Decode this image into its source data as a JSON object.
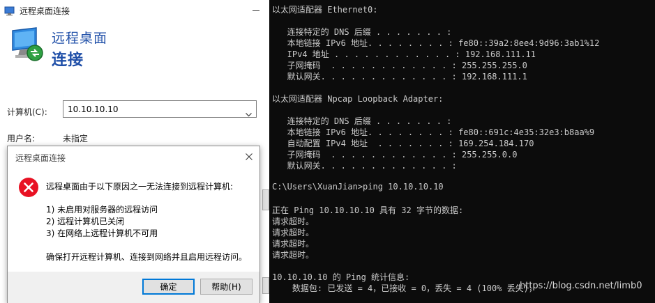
{
  "rdp_window": {
    "title": "远程桌面连接",
    "banner_title": "远程桌面",
    "banner_subtitle": "连接",
    "computer_label": "计算机(C):",
    "computer_value": "10.10.10.10",
    "username_label": "用户名:",
    "username_value": "未指定"
  },
  "error_dialog": {
    "title": "远程桌面连接",
    "message": "远程桌面由于以下原因之一无法连接到远程计算机:",
    "reasons": [
      "1) 未启用对服务器的远程访问",
      "2) 远程计算机已关闭",
      "3) 在网络上远程计算机不可用"
    ],
    "hint": "确保打开远程计算机、连接到网络并且启用远程访问。",
    "ok_label": "确定",
    "help_label": "帮助(H)"
  },
  "console": {
    "lines": [
      "以太网适配器 Ethernet0:",
      "",
      "   连接特定的 DNS 后缀 . . . . . . . :",
      "   本地链接 IPv6 地址. . . . . . . . : fe80::39a2:8ee4:9d96:3ab1%12",
      "   IPv4 地址 . . . . . . . . . . . . : 192.168.111.11",
      "   子网掩码  . . . . . . . . . . . . : 255.255.255.0",
      "   默认网关. . . . . . . . . . . . . : 192.168.111.1",
      "",
      "以太网适配器 Npcap Loopback Adapter:",
      "",
      "   连接特定的 DNS 后缀 . . . . . . . :",
      "   本地链接 IPv6 地址. . . . . . . . : fe80::691c:4e35:32e3:b8aa%9",
      "   自动配置 IPv4 地址  . . . . . . . : 169.254.184.170",
      "   子网掩码  . . . . . . . . . . . . : 255.255.0.0",
      "   默认网关. . . . . . . . . . . . . :",
      "",
      "C:\\Users\\XuanJian>ping 10.10.10.10",
      "",
      "正在 Ping 10.10.10.10 具有 32 字节的数据:",
      "请求超时。",
      "请求超时。",
      "请求超时。",
      "请求超时。",
      "",
      "10.10.10.10 的 Ping 统计信息:",
      "    数据包: 已发送 = 4，已接收 = 0，丢失 = 4 (100% 丢失)，"
    ],
    "watermark": "https://blog.csdn.net/limb0"
  },
  "colors": {
    "console_bg": "#0c0c0c",
    "console_text": "#cccccc",
    "rdp_accent": "#1f4fa8",
    "error_red": "#e81123",
    "button_focus": "#0078d7"
  }
}
